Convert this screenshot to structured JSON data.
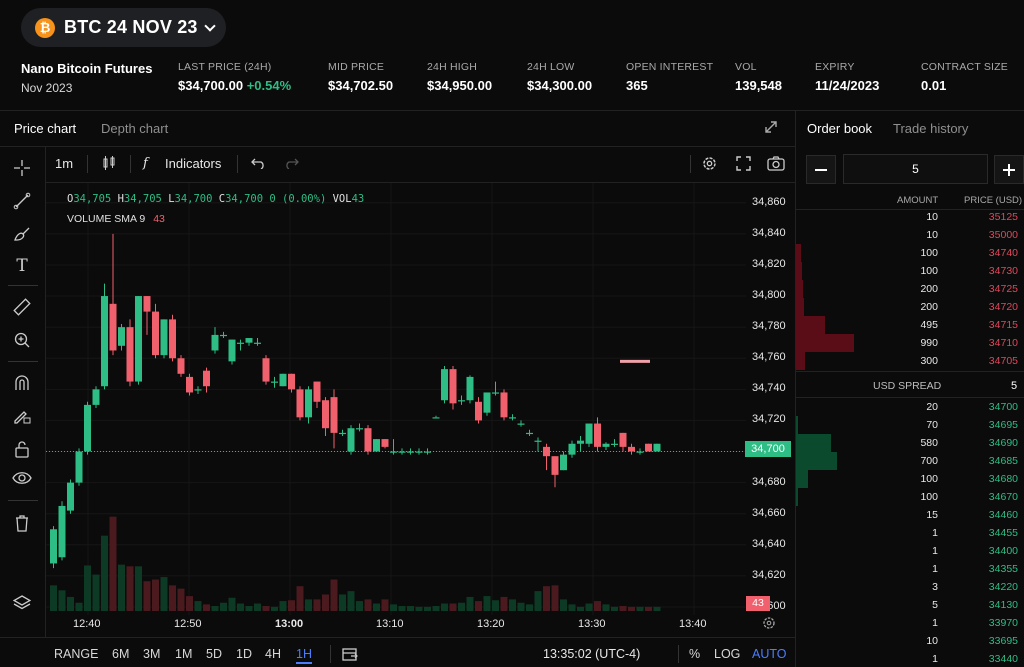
{
  "header": {
    "symbol": "BTC 24 NOV 23",
    "logo_letter": "₿",
    "product_name": "Nano Bitcoin Futures",
    "product_month": "Nov 2023",
    "stats": [
      {
        "label": "LAST PRICE (24H)",
        "value": "$34,700.00",
        "change": "+0.54%"
      },
      {
        "label": "MID PRICE",
        "value": "$34,702.50"
      },
      {
        "label": "24H HIGH",
        "value": "$34,950.00"
      },
      {
        "label": "24H LOW",
        "value": "$34,300.00"
      },
      {
        "label": "OPEN INTEREST",
        "value": "365"
      },
      {
        "label": "VOL",
        "value": "139,548"
      },
      {
        "label": "EXPIRY",
        "value": "11/24/2023"
      },
      {
        "label": "CONTRACT SIZE",
        "value": "0.01"
      }
    ]
  },
  "chart_tabs": {
    "price": "Price chart",
    "depth": "Depth chart"
  },
  "toolbar": {
    "interval": "1m",
    "indicators": "Indicators",
    "fx": "f"
  },
  "legend": {
    "o_label": "O",
    "o": "34,705",
    "h_label": "H",
    "h": "34,705",
    "l_label": "L",
    "l": "34,700",
    "c_label": "C",
    "c": "34,700",
    "chg": "0 (0.00%)",
    "vol_label": "VOL",
    "vol": "43",
    "vol_sma_label": "VOLUME SMA 9",
    "vol_sma": "43"
  },
  "price_tag": "34,700",
  "vol_tag": "43",
  "colors": {
    "up": "#2ebd85",
    "down": "#f0616d",
    "up_vol": "#0d3a25",
    "down_vol": "#4a1a1e",
    "accent": "#4d7cfe"
  },
  "chart_data": {
    "type": "candlestick",
    "ylim": [
      34600,
      34865
    ],
    "y_ticks": [
      "34,860",
      "34,840",
      "34,820",
      "34,800",
      "34,780",
      "34,760",
      "34,740",
      "34,720",
      "34,700",
      "34,680",
      "34,660",
      "34,640",
      "34,620",
      "34,600"
    ],
    "y_tick_values": [
      34860,
      34840,
      34820,
      34800,
      34780,
      34760,
      34740,
      34720,
      34700,
      34680,
      34660,
      34640,
      34620,
      34600
    ],
    "x_ticks": [
      {
        "label": "12:40",
        "bold": false
      },
      {
        "label": "12:50",
        "bold": false
      },
      {
        "label": "13:00",
        "bold": true
      },
      {
        "label": "13:10",
        "bold": false
      },
      {
        "label": "13:20",
        "bold": false
      },
      {
        "label": "13:30",
        "bold": false
      },
      {
        "label": "13:40",
        "bold": false
      }
    ],
    "candles": [
      [
        34628,
        34650,
        34625,
        34652,
        31
      ],
      [
        34632,
        34665,
        34630,
        34668,
        25
      ],
      [
        34662,
        34680,
        34660,
        34682,
        17
      ],
      [
        34680,
        34700,
        34678,
        34702,
        10
      ],
      [
        34700,
        34730,
        34698,
        34732,
        55
      ],
      [
        34730,
        34740,
        34728,
        34742,
        44
      ],
      [
        34742,
        34800,
        34740,
        34808,
        91
      ],
      [
        34795,
        34765,
        34762,
        34840,
        114
      ],
      [
        34768,
        34780,
        34765,
        34782,
        56
      ],
      [
        34780,
        34745,
        34742,
        34785,
        54
      ],
      [
        34745,
        34800,
        34743,
        34800,
        54
      ],
      [
        34800,
        34790,
        34775,
        34800,
        36
      ],
      [
        34790,
        34762,
        34760,
        34795,
        38
      ],
      [
        34762,
        34785,
        34760,
        34785,
        41
      ],
      [
        34785,
        34760,
        34758,
        34788,
        31
      ],
      [
        34760,
        34750,
        34748,
        34762,
        27
      ],
      [
        34748,
        34738,
        34736,
        34750,
        18
      ],
      [
        34740,
        34740,
        34737,
        34742,
        12
      ],
      [
        34752,
        34742,
        34738,
        34754,
        8
      ],
      [
        34765,
        34775,
        34763,
        34780,
        6
      ],
      [
        34775,
        34775,
        34773,
        34777,
        10
      ],
      [
        34758,
        34772,
        34756,
        34772,
        16
      ],
      [
        34770,
        34770,
        34765,
        34772,
        9
      ],
      [
        34770,
        34773,
        34768,
        34773,
        6
      ],
      [
        34770,
        34770,
        34768,
        34773,
        9
      ],
      [
        34760,
        34745,
        34743,
        34762,
        6
      ],
      [
        34745,
        34745,
        34741,
        34748,
        5
      ],
      [
        34742,
        34750,
        34742,
        34750,
        12
      ],
      [
        34750,
        34740,
        34738,
        34750,
        13
      ],
      [
        34740,
        34722,
        34720,
        34742,
        30
      ],
      [
        34722,
        34740,
        34718,
        34742,
        14
      ],
      [
        34745,
        34732,
        34728,
        34745,
        14
      ],
      [
        34733,
        34715,
        34710,
        34735,
        20
      ],
      [
        34735,
        34712,
        34702,
        34740,
        38
      ],
      [
        34712,
        34712,
        34710,
        34714,
        20
      ],
      [
        34700,
        34715,
        34698,
        34717,
        24
      ],
      [
        34715,
        34715,
        34713,
        34718,
        12
      ],
      [
        34715,
        34700,
        34698,
        34717,
        14
      ],
      [
        34700,
        34708,
        34700,
        34708,
        9
      ],
      [
        34708,
        34703,
        34702,
        34708,
        14
      ],
      [
        34700,
        34700,
        34698,
        34708,
        8
      ],
      [
        34700,
        34700,
        34698,
        34702,
        6
      ],
      [
        34700,
        34700,
        34698,
        34702,
        6
      ],
      [
        34700,
        34700,
        34698,
        34702,
        5
      ],
      [
        34700,
        34700,
        34698,
        34702,
        5
      ],
      [
        34722,
        34722,
        34722,
        34723,
        6
      ],
      [
        34733,
        34753,
        34731,
        34755,
        9
      ],
      [
        34753,
        34731,
        34727,
        34755,
        9
      ],
      [
        34733,
        34733,
        34730,
        34736,
        10
      ],
      [
        34733,
        34748,
        34731,
        34749,
        17
      ],
      [
        34732,
        34720,
        34718,
        34735,
        12
      ],
      [
        34725,
        34738,
        34723,
        34738,
        18
      ],
      [
        34738,
        34738,
        34736,
        34745,
        13
      ],
      [
        34738,
        34722,
        34720,
        34740,
        17
      ],
      [
        34722,
        34722,
        34720,
        34724,
        14
      ],
      [
        34718,
        34718,
        34716,
        34720,
        10
      ],
      [
        34712,
        34712,
        34710,
        34714,
        8
      ],
      [
        34707,
        34707,
        34700,
        34709,
        24
      ],
      [
        34703,
        34697,
        34688,
        34705,
        30
      ],
      [
        34697,
        34685,
        34677,
        34697,
        31
      ],
      [
        34688,
        34698,
        34688,
        34700,
        14
      ],
      [
        34698,
        34705,
        34696,
        34707,
        8
      ],
      [
        34705,
        34707,
        34700,
        34710,
        5
      ],
      [
        34705,
        34718,
        34703,
        34718,
        9
      ],
      [
        34718,
        34703,
        34700,
        34722,
        12
      ],
      [
        34703,
        34705,
        34701,
        34706,
        8
      ],
      [
        34705,
        34705,
        34703,
        34708,
        5
      ],
      [
        34712,
        34703,
        34700,
        34712,
        6
      ],
      [
        34703,
        34700,
        34698,
        34705,
        5
      ],
      [
        34700,
        34700,
        34698,
        34702,
        5
      ],
      [
        34705,
        34700,
        34700,
        34705,
        5
      ],
      [
        34700,
        34705,
        34700,
        34705,
        5
      ]
    ],
    "volume_max": 145,
    "stray_marks": [
      {
        "price": 34758,
        "index": 68
      }
    ]
  },
  "ranges": [
    "RANGE",
    "6M",
    "3M",
    "1M",
    "5D",
    "1D",
    "4H",
    "1H"
  ],
  "active_range": "1H",
  "clock": "13:35:02 (UTC-4)",
  "bottom_right": {
    "pct": "%",
    "log": "LOG",
    "auto": "AUTO"
  },
  "orderbook": {
    "tabs": {
      "book": "Order book",
      "history": "Trade history"
    },
    "step_value": "5",
    "head_amount": "AMOUNT",
    "head_price": "PRICE (USD)",
    "asks": [
      {
        "amount": "10",
        "price": "35125",
        "depth": 0
      },
      {
        "amount": "10",
        "price": "35000",
        "depth": 0
      },
      {
        "amount": "100",
        "price": "34740",
        "depth": 0.04
      },
      {
        "amount": "100",
        "price": "34730",
        "depth": 0.05
      },
      {
        "amount": "200",
        "price": "34725",
        "depth": 0.06
      },
      {
        "amount": "200",
        "price": "34720",
        "depth": 0.07
      },
      {
        "amount": "495",
        "price": "34715",
        "depth": 0.25
      },
      {
        "amount": "990",
        "price": "34710",
        "depth": 0.5
      },
      {
        "amount": "300",
        "price": "34705",
        "depth": 0.08
      }
    ],
    "spread_label": "USD SPREAD",
    "spread_value": "5",
    "bids": [
      {
        "amount": "20",
        "price": "34700",
        "depth": 0
      },
      {
        "amount": "70",
        "price": "34695",
        "depth": 0.02
      },
      {
        "amount": "580",
        "price": "34690",
        "depth": 0.3
      },
      {
        "amount": "700",
        "price": "34685",
        "depth": 0.36
      },
      {
        "amount": "100",
        "price": "34680",
        "depth": 0.1
      },
      {
        "amount": "100",
        "price": "34670",
        "depth": 0.02
      },
      {
        "amount": "15",
        "price": "34460",
        "depth": 0
      },
      {
        "amount": "1",
        "price": "34455",
        "depth": 0
      },
      {
        "amount": "1",
        "price": "34400",
        "depth": 0
      },
      {
        "amount": "1",
        "price": "34355",
        "depth": 0
      },
      {
        "amount": "3",
        "price": "34220",
        "depth": 0
      },
      {
        "amount": "5",
        "price": "34130",
        "depth": 0
      },
      {
        "amount": "1",
        "price": "33970",
        "depth": 0
      },
      {
        "amount": "10",
        "price": "33695",
        "depth": 0
      },
      {
        "amount": "1",
        "price": "33440",
        "depth": 0
      }
    ]
  }
}
